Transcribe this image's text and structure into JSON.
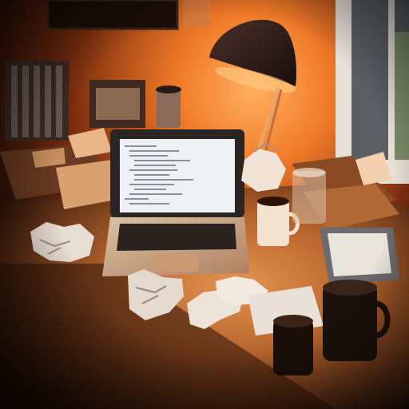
{
  "scene": {
    "description_kind": "photo",
    "palette": {
      "wall_glow": "#f07a28",
      "wall_dark": "#2a0f06",
      "desk_lit": "#c9773e",
      "desk_dark": "#3a1b0c",
      "lamp": "#2b1a14",
      "laptop_body": "#b9a48e",
      "screen": "#eef0f3",
      "window_frame": "#d8d4cc"
    }
  }
}
